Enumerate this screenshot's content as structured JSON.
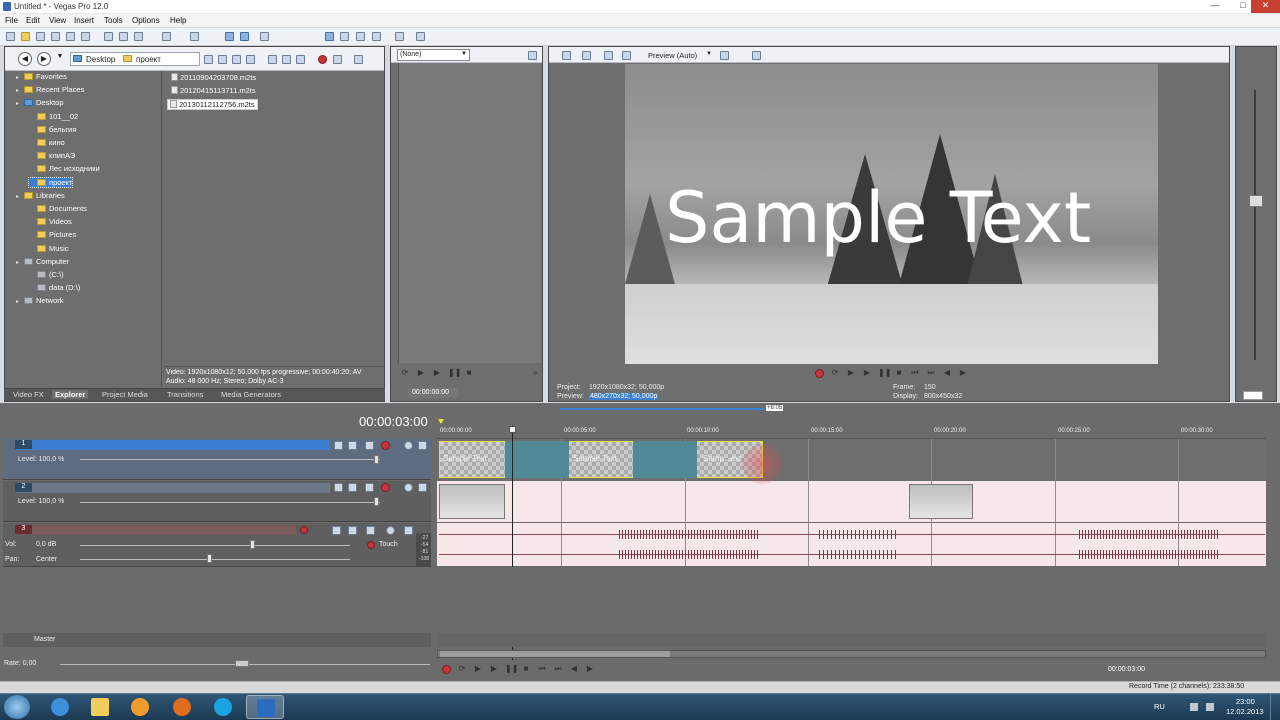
{
  "window": {
    "title": "Untitled * - Vegas Pro 12.0",
    "min": "—",
    "max": "□",
    "close": "✕"
  },
  "menu": [
    "File",
    "Edit",
    "View",
    "Insert",
    "Tools",
    "Options",
    "Help"
  ],
  "explorer": {
    "location": "Desktop",
    "location2": "проект",
    "tree": [
      {
        "label": "Favorites",
        "level": 1,
        "icon": "folder"
      },
      {
        "label": "Recent Places",
        "level": 1,
        "icon": "folder"
      },
      {
        "label": "Desktop",
        "level": 1,
        "icon": "blue"
      },
      {
        "label": "101__02",
        "level": 2,
        "icon": "folder"
      },
      {
        "label": "бельгия",
        "level": 2,
        "icon": "folder"
      },
      {
        "label": "кино",
        "level": 2,
        "icon": "folder"
      },
      {
        "label": "клипАЭ",
        "level": 2,
        "icon": "folder"
      },
      {
        "label": "Лес исходники",
        "level": 2,
        "icon": "folder"
      },
      {
        "label": "проект",
        "level": 2,
        "icon": "folder",
        "selected": true
      },
      {
        "label": "Libraries",
        "level": 1,
        "icon": "folder"
      },
      {
        "label": "Documents",
        "level": 2,
        "icon": "folder"
      },
      {
        "label": "Videos",
        "level": 2,
        "icon": "folder"
      },
      {
        "label": "Pictures",
        "level": 2,
        "icon": "folder"
      },
      {
        "label": "Music",
        "level": 2,
        "icon": "folder"
      },
      {
        "label": "Computer",
        "level": 1,
        "icon": "gray"
      },
      {
        "label": "(C:\\)",
        "level": 2,
        "icon": "gray"
      },
      {
        "label": "data (D:\\)",
        "level": 2,
        "icon": "gray"
      },
      {
        "label": "Network",
        "level": 1,
        "icon": "gray"
      }
    ],
    "files": [
      "20110904203708.m2ts",
      "20120415113711.m2ts",
      "20130112112756.m2ts"
    ],
    "info_line1": "Video: 1920x1080x12; 50,000 fps progressive; 00:00:40:20; AV",
    "info_line2": "Audio: 48 000 Hz; Stereo; Dolby AC-3"
  },
  "tabs": [
    "Video FX",
    "Explorer",
    "Project Media",
    "Transitions",
    "Media Generators"
  ],
  "trimmer": {
    "dropdown": "(None)",
    "time": "00:00:00:00"
  },
  "preview": {
    "mode": "Preview (Auto)",
    "overlay_text": "Sample Text",
    "project_label": "Project:",
    "project_value": "1920x1080x32; 50,000p",
    "preview_label": "Preview:",
    "preview_value": "480x270x32; 50,000p",
    "frame_label": "Frame:",
    "frame_value": "150",
    "display_label": "Display:",
    "display_value": "800x450x32"
  },
  "timeline": {
    "current_time": "00:00:03:00",
    "marker": "+8:05",
    "ruler": [
      "00:00:00:00",
      "00:00:05:00",
      "00:00:10:00",
      "00:00:15:00",
      "00:00:20:00",
      "00:00:25:00",
      "00:00:30:00"
    ],
    "tracks": [
      {
        "num": "1",
        "level_label": "Level: 100,0 %"
      },
      {
        "num": "2",
        "level_label": "Level: 100,0 %"
      },
      {
        "num": "3",
        "vol_label": "Vol:",
        "vol_value": "0,0 dB",
        "pan_label": "Pan:",
        "pan_value": "Center",
        "touch": "Touch",
        "meter": [
          "-27",
          "-54",
          "-81",
          "-108"
        ]
      }
    ],
    "clip_text": [
      "Sample Text",
      "Sample Text",
      "Samp...ext"
    ],
    "master_label": "Master",
    "rate": "Rate: 0,00",
    "end_time": "00:00:03:00",
    "record_time": "Record Time (2 channels): 233:38:50"
  },
  "taskbar": {
    "lang": "RU",
    "clock_time": "23:00",
    "clock_date": "12.02.2013",
    "apps": [
      "start",
      "internet-explorer",
      "file-explorer",
      "media-player",
      "firefox",
      "skype",
      "vegas"
    ]
  },
  "colors": {
    "selection": "#3a7fd0",
    "clip_trans": "#4f8a96",
    "accent_yellow": "#e8e33a"
  }
}
